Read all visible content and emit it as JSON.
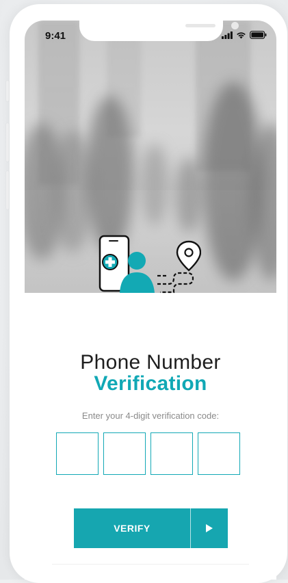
{
  "status_bar": {
    "time": "9:41",
    "icons": [
      "signal-icon",
      "wifi-icon",
      "battery-icon"
    ]
  },
  "hero": {
    "image": "blurred-city-crowd-photo",
    "illustration_icons": [
      "phone-medical-cross-icon",
      "user-avatar-icon",
      "location-pin-icon"
    ]
  },
  "verification": {
    "title_line1": "Phone Number",
    "title_line2": "Verification",
    "instruction": "Enter your 4-digit verification code:",
    "code_digits": [
      "",
      "",
      "",
      ""
    ],
    "verify_label": "VERIFY"
  },
  "colors": {
    "accent": "#11a8b5",
    "button": "#16a6b0",
    "title": "#1e1e1e",
    "muted": "#8a8a8a"
  }
}
